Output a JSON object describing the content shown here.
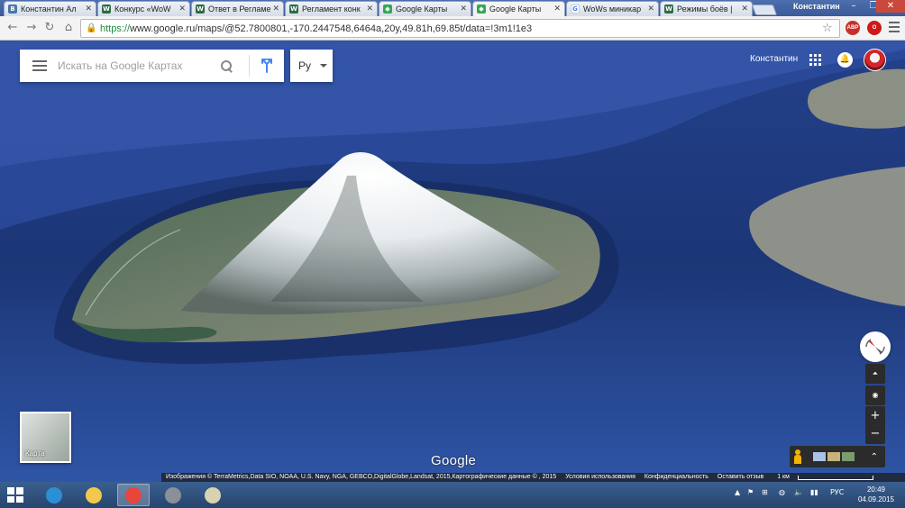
{
  "browser": {
    "tabs": [
      {
        "title": "Константин Ал",
        "favicon": "vk-icon",
        "color": "#4a76a8",
        "glyph": "B"
      },
      {
        "title": "Конкурс «WoW",
        "favicon": "shield-icon",
        "color": "#2e6b46",
        "glyph": "W"
      },
      {
        "title": "Ответ в Регламе",
        "favicon": "shield-icon",
        "color": "#2e6b46",
        "glyph": "W"
      },
      {
        "title": "Регламент конк",
        "favicon": "shield-icon",
        "color": "#2e6b46",
        "glyph": "W"
      },
      {
        "title": "Google Карты",
        "favicon": "maps-icon",
        "color": "#34a853",
        "glyph": "◆"
      },
      {
        "title": "Google Карты",
        "favicon": "maps-icon",
        "color": "#34a853",
        "glyph": "◆"
      },
      {
        "title": "WoWs миникар",
        "favicon": "google-icon",
        "color": "#ffffff",
        "glyph": "G"
      },
      {
        "title": "Режимы боёв |",
        "favicon": "shield-icon",
        "color": "#2e6b46",
        "glyph": "W"
      }
    ],
    "active_tab": 5,
    "profile": "Константин",
    "url_scheme": "https://",
    "url_rest": "www.google.ru/maps/@52.7800801,-170.2447548,6464a,20y,49.81h,69.85t/data=!3m1!1e3",
    "extensions": [
      {
        "name": "adblock-icon",
        "label": "ABP",
        "color": "#c9302c"
      },
      {
        "name": "opera-icon",
        "label": "O",
        "color": "#cc1a1a"
      }
    ]
  },
  "maps": {
    "search_placeholder": "Искать на Google Картах",
    "language": "Ру",
    "user_name": "Константин",
    "google_label": "Google",
    "minimap_label": "Карта",
    "zoom_in": "+",
    "zoom_out": "−",
    "tilt": "⏶",
    "attribution": {
      "imagery": "Изображения © TerraMetrics,Data SIO, NOAA, U.S. Navy, NGA, GEBCO,DigitalGlobe,Landsat, 2015,Картографические данные ©  , 2015",
      "terms": "Условия использования",
      "privacy": "Конфиденциальность",
      "feedback": "Оставить отзыв",
      "scale": "1 км"
    }
  },
  "taskbar": {
    "apps": [
      {
        "name": "ie-icon",
        "color": "#2b8fd6"
      },
      {
        "name": "explorer-icon",
        "color": "#f2c94c"
      },
      {
        "name": "chrome-icon",
        "color": "#e8453c"
      },
      {
        "name": "wows-icon",
        "color": "#8a8f99"
      },
      {
        "name": "paint-icon",
        "color": "#d9d2b0"
      }
    ],
    "active_app": 2,
    "language": "РУС",
    "time": "20:49",
    "date": "04.09.2015"
  }
}
